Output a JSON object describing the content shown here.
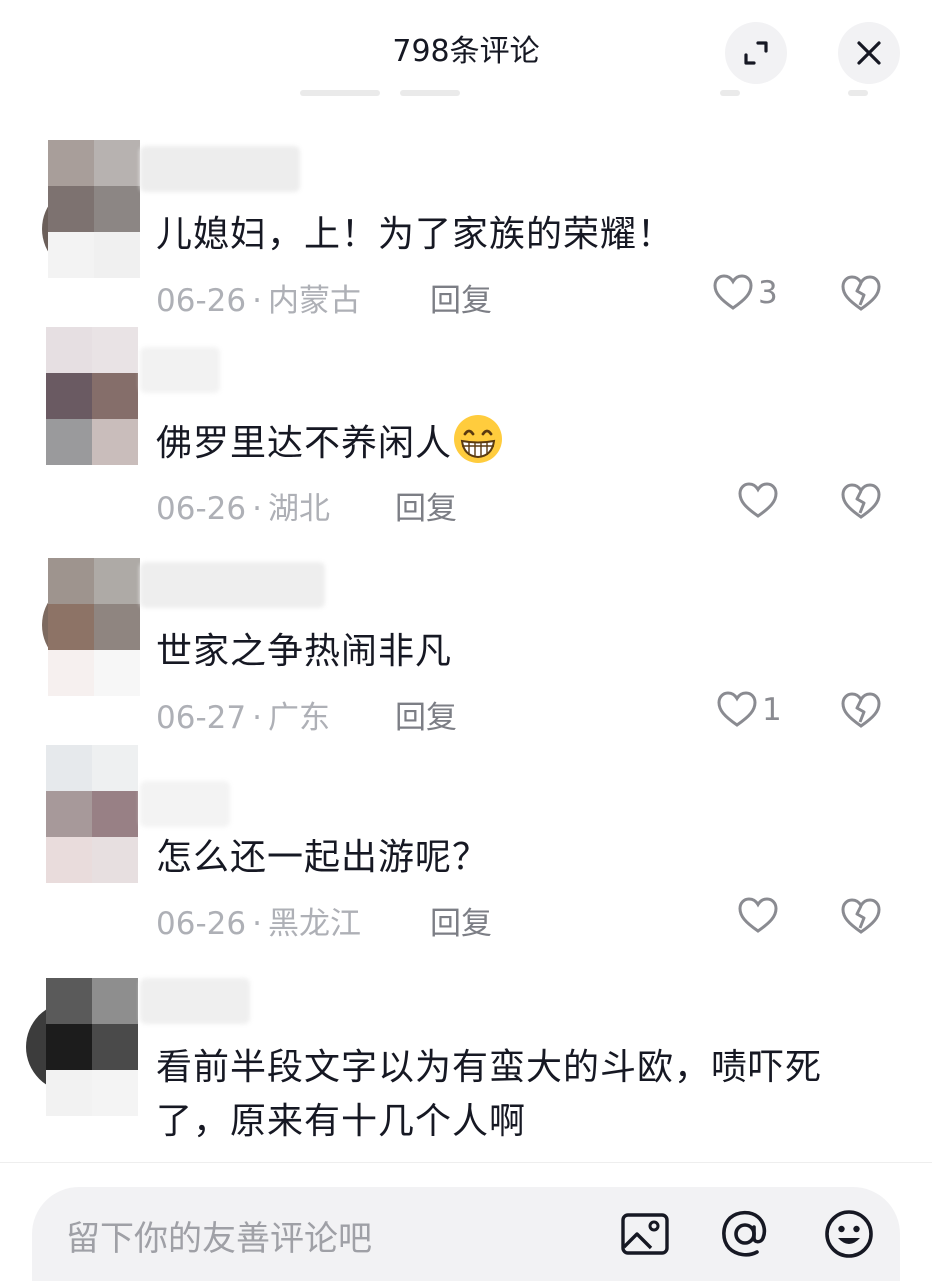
{
  "header": {
    "title": "798条评论"
  },
  "comments": [
    {
      "text": "儿媳妇，上！为了家族的荣耀！",
      "date": "06-26",
      "region": "内蒙古",
      "reply": "回复",
      "likes": "3"
    },
    {
      "text": "佛罗里达不养闲人",
      "emoji": "grinning-face-emoji",
      "date": "06-26",
      "region": "湖北",
      "reply": "回复",
      "likes": ""
    },
    {
      "text": "世家之争热闹非凡",
      "date": "06-27",
      "region": "广东",
      "reply": "回复",
      "likes": "1"
    },
    {
      "text": "怎么还一起出游呢？",
      "date": "06-26",
      "region": "黑龙江",
      "reply": "回复",
      "likes": ""
    },
    {
      "text_line1": "看前半段文字以为有蛮大的斗欧，啧吓死",
      "text_line2": "了，原来有十几个人啊"
    }
  ],
  "footer": {
    "placeholder": "留下你的友善评论吧"
  },
  "icons": [
    "expand-icon",
    "close-icon",
    "heart-icon",
    "broken-heart-icon",
    "image-icon",
    "at-icon",
    "smiley-icon"
  ],
  "colors": {
    "text": "#161823",
    "meta": "#aeb0b6",
    "reply": "#7c7e85",
    "button_bg": "#f2f2f4"
  }
}
